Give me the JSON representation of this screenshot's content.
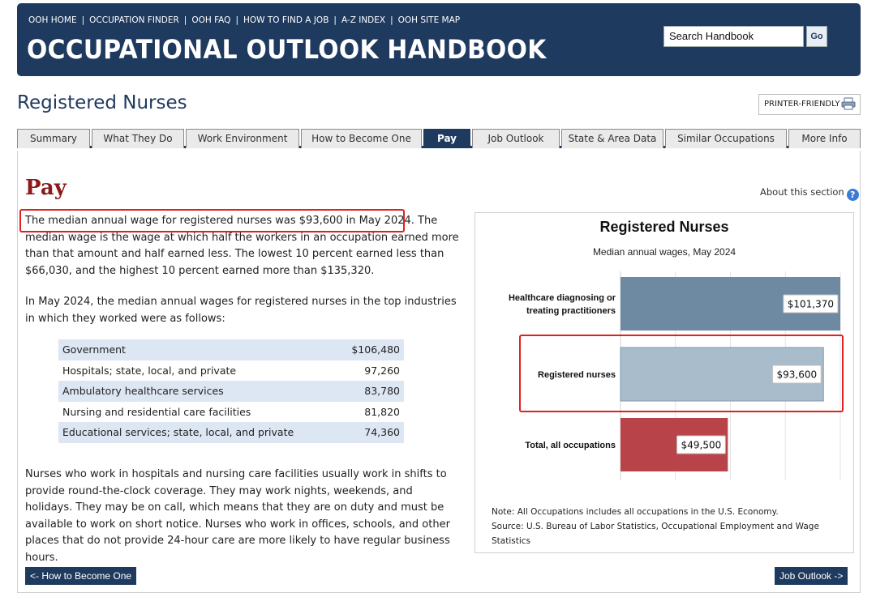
{
  "header": {
    "links": [
      "OOH HOME",
      "OCCUPATION FINDER",
      "OOH FAQ",
      "HOW TO FIND A JOB",
      "A-Z INDEX",
      "OOH SITE MAP"
    ],
    "brand": "OCCUPATIONAL OUTLOOK HANDBOOK",
    "search_value": "Search Handbook",
    "search_go": "Go"
  },
  "page_title": "Registered Nurses",
  "printer_label": "PRINTER-FRIENDLY",
  "tabs": [
    "Summary",
    "What They Do",
    "Work Environment",
    "How to Become One",
    "Pay",
    "Job Outlook",
    "State & Area Data",
    "Similar Occupations",
    "More Info"
  ],
  "active_tab": "Pay",
  "section": {
    "heading": "Pay",
    "about": "About this section",
    "p1_highlight": "The median annual wage for registered nurses was $93,600 in May 2024.",
    "p1_rest": " The median wage is the wage at which half the workers in an occupation earned more than that amount and half earned less. The lowest 10 percent earned less than $66,030, and the highest 10 percent earned more than $135,320.",
    "p2": "In May 2024, the median annual wages for registered nurses in the top industries in which they worked were as follows:",
    "industries": [
      {
        "name": "Government",
        "value": "$106,480"
      },
      {
        "name": "Hospitals; state, local, and private",
        "value": "97,260"
      },
      {
        "name": "Ambulatory healthcare services",
        "value": "83,780"
      },
      {
        "name": "Nursing and residential care facilities",
        "value": "81,820"
      },
      {
        "name": "Educational services; state, local, and private",
        "value": "74,360"
      }
    ],
    "p3": "Nurses who work in hospitals and nursing care facilities usually work in shifts to provide round-the-clock coverage. They may work nights, weekends, and holidays. They may be on call, which means that they are on duty and must be available to work on short notice. Nurses who work in offices, schools, and other places that do not provide 24-hour care are more likely to have regular business hours."
  },
  "nav": {
    "prev": "<- How to Become One",
    "next": "Job Outlook ->"
  },
  "chart_data": {
    "type": "bar",
    "orientation": "horizontal",
    "title": "Registered Nurses",
    "subtitle": "Median annual wages, May 2024",
    "categories": [
      "Healthcare diagnosing or treating practitioners",
      "Registered nurses",
      "Total, all occupations"
    ],
    "values": [
      101370,
      93600,
      49500
    ],
    "value_labels": [
      "$101,370",
      "$93,600",
      "$49,500"
    ],
    "colors": [
      "#6e8aa3",
      "#a9bccb",
      "#b8444a"
    ],
    "xlim": [
      0,
      101370
    ],
    "note": "Note: All Occupations includes all occupations in the U.S. Economy.",
    "source": "Source: U.S. Bureau of Labor Statistics, Occupational Employment and Wage Statistics"
  }
}
